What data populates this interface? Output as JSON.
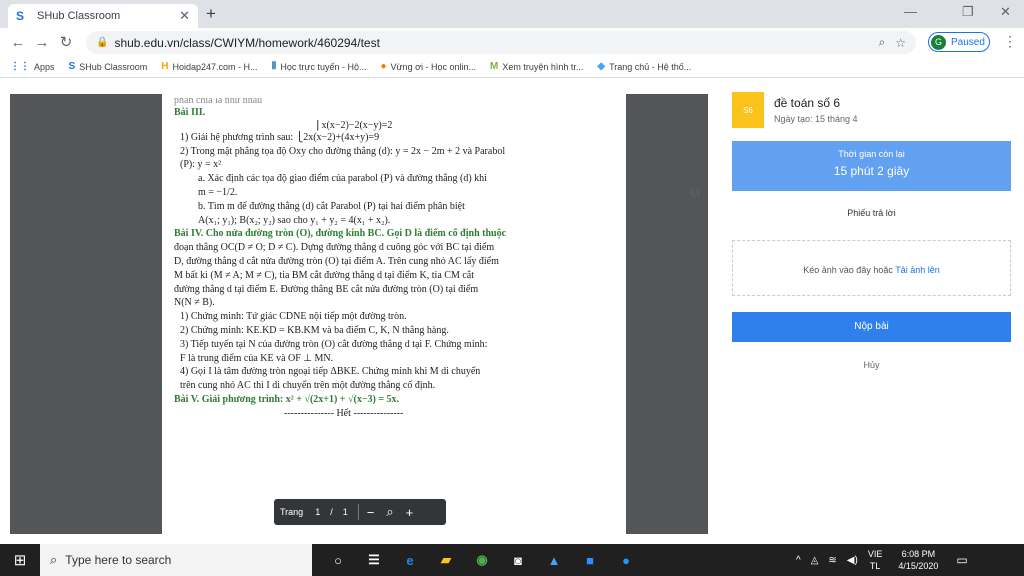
{
  "browser": {
    "tab_title": "SHub Classroom",
    "tab_icon": "S",
    "url": "shub.edu.vn/class/CWIYM/homework/460294/test",
    "profile_initial": "G",
    "profile_label": "Paused"
  },
  "bookmarks": [
    {
      "label": "Apps",
      "icon": "grid-icon"
    },
    {
      "label": "SHub Classroom",
      "icon": "shub-icon"
    },
    {
      "label": "Hoidap247.com - H...",
      "icon": "hoidap-icon"
    },
    {
      "label": "Học trực tuyến - Hộ...",
      "icon": "hoc-icon"
    },
    {
      "label": "Vừng ơi - Học onlin...",
      "icon": "vung-icon"
    },
    {
      "label": "Xem truyện hình tr...",
      "icon": "truyen-icon"
    },
    {
      "label": "Trang chủ - Hệ thố...",
      "icon": "trangchu-icon"
    }
  ],
  "pdf": {
    "lines": [
      "Bài III.",
      "⎧x(x−2)−2(x−y)=2",
      "1) Giải hệ phương trình sau: ⎩2x(x−2)+(4x+y)=9",
      "2) Trong mặt phẳng tọa độ Oxy cho đường thẳng (d): y = 2x − 2m + 2 và Parabol",
      "(P): y = x²",
      "a. Xác định các tọa độ giao điểm của parabol (P) và đường thẳng (d) khi",
      "m = −1/2.",
      "b. Tìm m để đường thẳng (d) cắt Parabol (P) tại hai điểm phân biệt",
      "A(x₁; y₁); B(x₂; y₂) sao cho y₁ + y₂ = 4(x₁ + x₂).",
      "Bài IV. Cho nửa đường tròn (O), đường kính BC. Gọi D là điểm cố định thuộc",
      "đoạn thẳng OC(D ≠ O; D ≠ C). Dựng đường thẳng d cuông góc với BC tại điểm",
      "D, đường thẳng d cắt nửa đường tròn (O) tại điểm A. Trên cung nhỏ AC lấy điểm",
      "M bất kì (M ≠ A; M ≠ C), tia BM cắt đường thẳng d tại điểm K, tia CM cắt",
      "đường thẳng d tại điểm E. Đường thẳng BE cắt nửa đường tròn (O) tại điểm",
      "N(N ≠ B).",
      "1) Chứng minh: Tứ giác CDNE nội tiếp một đường tròn.",
      "2) Chứng minh: KE.KD = KB.KM và ba điểm C, K, N thẳng hàng.",
      "3) Tiếp tuyến tại N của đường tròn (O) cắt đường thẳng d tại F. Chứng minh:",
      "F là trung điểm của KE và OF ⊥ MN.",
      "4) Gọi I là tâm đường tròn ngoại tiếp ΔBKE. Chứng minh khi M di chuyển",
      "trên cung nhỏ AC thì I di chuyển trên một đường thẳng cố định.",
      "Bài V. Giải phương trình: x² + √(2x+1) + √(x−3) = 5x.",
      "--------------- Hết ---------------"
    ],
    "page_label": "Trang",
    "page_current": "1",
    "page_sep": "/",
    "page_total": "1"
  },
  "sidebar": {
    "avatar_text": "S6",
    "title": "đề toán số 6",
    "date": "Ngày tạo: 15 tháng 4",
    "time_label": "Thời gian còn lại",
    "time_value": "15 phút 2 giây",
    "answer_label": "Phiếu trả lời",
    "drop_text": "Kéo ảnh vào đây hoặc",
    "drop_link": "Tải ảnh lên",
    "submit": "Nộp bài",
    "cancel": "Hủy"
  },
  "taskbar": {
    "search_placeholder": "Type here to search",
    "lang1": "VIE",
    "lang2": "TL",
    "time": "6:08 PM",
    "date": "4/15/2020"
  },
  "colors": {
    "accent": "#2f80ed",
    "timer": "#62a0f2",
    "title_green": "#2e7d32"
  }
}
